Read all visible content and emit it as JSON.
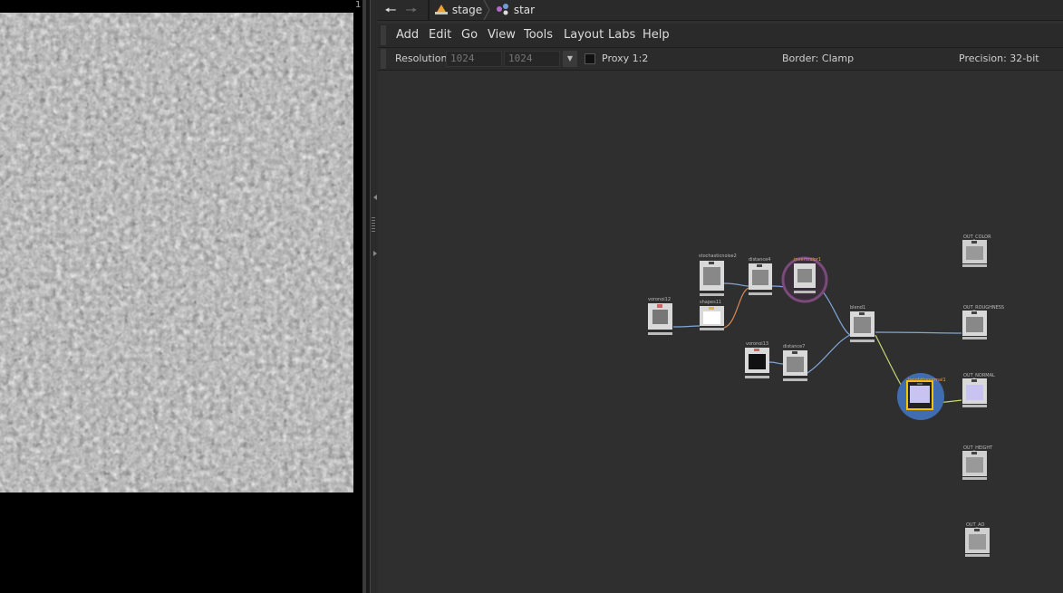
{
  "viewer": {
    "corner_mark": "1"
  },
  "pathbar": {
    "back_icon": "arrow-left-icon",
    "forward_icon": "arrow-right-icon",
    "crumbs": [
      {
        "label": "stage",
        "icon": "stage-icon"
      },
      {
        "label": "star",
        "icon": "network-icon"
      }
    ]
  },
  "menubar": {
    "items": [
      "Add",
      "Edit",
      "Go",
      "View",
      "Tools",
      "Layout",
      "Labs",
      "Help"
    ]
  },
  "toolbar": {
    "resolution_label": "Resolution",
    "res_x_placeholder": "1024",
    "res_y_placeholder": "1024",
    "proxy_label": "Proxy 1:2",
    "border_label": "Border: Clamp",
    "precision_label": "Precision: 32-bit"
  },
  "network": {
    "nodes": [
      {
        "id": "voronoi12",
        "label": "voronoi12"
      },
      {
        "id": "stochasticnoise2",
        "label": "stochasticnoise2"
      },
      {
        "id": "shapes11",
        "label": "shapes11"
      },
      {
        "id": "distance4",
        "label": "distance4"
      },
      {
        "id": "selected-circle",
        "label": "invertcolor1"
      },
      {
        "id": "voronoi13",
        "label": "voronoi13"
      },
      {
        "id": "distance7",
        "label": "distance7"
      },
      {
        "id": "blend",
        "label": "blend1"
      },
      {
        "id": "normal-display",
        "label": "heighttonormal1"
      },
      {
        "id": "out-color",
        "label": "OUT_COLOR"
      },
      {
        "id": "out-roughness",
        "label": "OUT_ROUGHNESS"
      },
      {
        "id": "out-normal",
        "label": "OUT_NORMAL"
      },
      {
        "id": "out-height",
        "label": "OUT_HEIGHT"
      },
      {
        "id": "out-ao",
        "label": "OUT_AO"
      }
    ]
  },
  "colors": {
    "wire_blue": "#7fa7d6",
    "wire_orange": "#d98a55",
    "wire_yellowgreen": "#c6d872",
    "selected_ring": "#7a4a7a",
    "display_ring": "#4a7ac8",
    "display_frame": "#f2c500"
  }
}
